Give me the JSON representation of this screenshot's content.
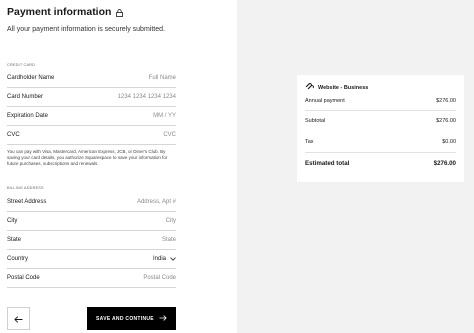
{
  "header": {
    "title": "Payment information",
    "subtitle": "All your payment information is securely submitted."
  },
  "credit_card": {
    "section_label": "CREDIT CARD",
    "cardholder_name": {
      "label": "Cardholder Name",
      "placeholder": "Full Name"
    },
    "card_number": {
      "label": "Card Number",
      "placeholder": "1234 1234 1234 1234"
    },
    "expiration_date": {
      "label": "Expiration Date",
      "placeholder": "MM / YY"
    },
    "cvc": {
      "label": "CVC",
      "placeholder": "CVC"
    },
    "note": "You can pay with Visa, Mastercard, American Express, JCB, or Diner's Club. By saving your card details, you authorize Squarespace to save your information for future purchases, subscriptions and renewals."
  },
  "billing_address": {
    "section_label": "BILLING ADDRESS",
    "street_address": {
      "label": "Street Address",
      "placeholder": "Address, Apt #"
    },
    "city": {
      "label": "City",
      "placeholder": "City"
    },
    "state": {
      "label": "State",
      "placeholder": "State"
    },
    "country": {
      "label": "Country",
      "value": "India"
    },
    "postal_code": {
      "label": "Postal Code",
      "placeholder": "Postal Code"
    }
  },
  "footer": {
    "back_icon": "arrow-left-icon",
    "save_label": "SAVE AND CONTINUE",
    "save_icon": "arrow-right-icon"
  },
  "summary": {
    "product_icon": "squarespace-logo-icon",
    "product": "Website - Business",
    "annual_payment_label": "Annual payment",
    "annual_payment_value": "$276.00",
    "subtotal_label": "Subtotal",
    "subtotal_value": "$276.00",
    "tax_label": "Tax",
    "tax_value": "$0.00",
    "total_label": "Estimated total",
    "total_value": "$276.00"
  }
}
